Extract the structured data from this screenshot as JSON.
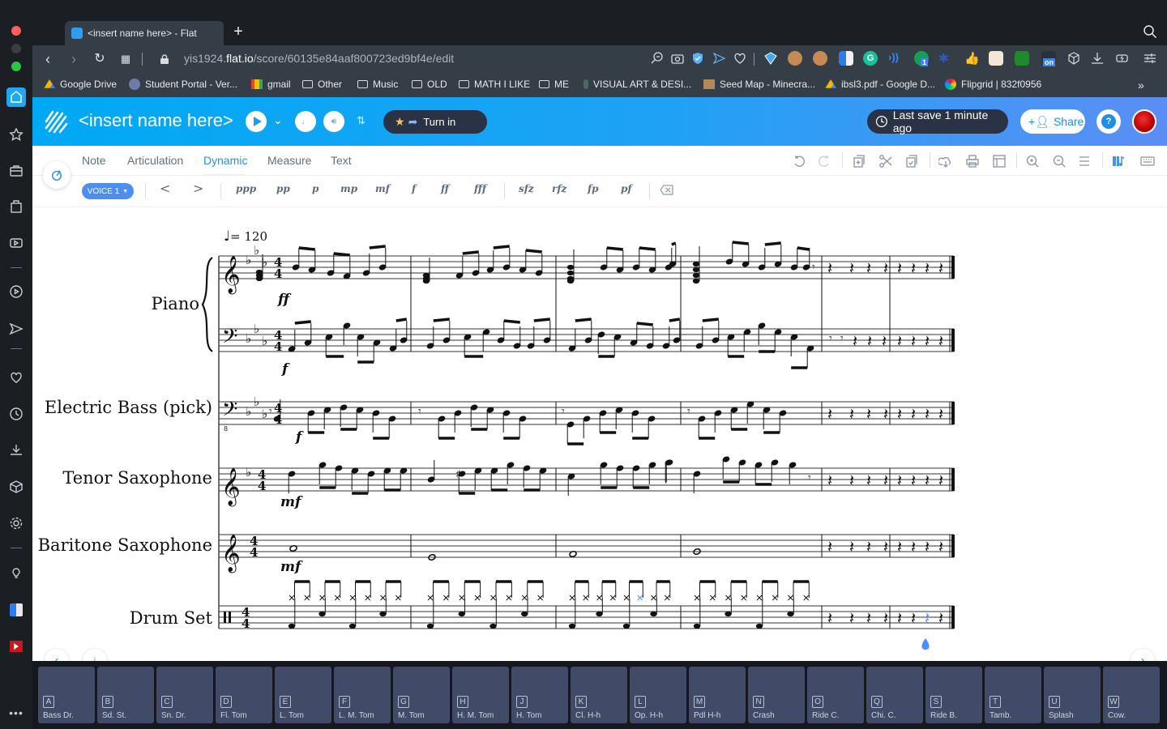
{
  "browser": {
    "tab_title": "<insert name here> - Flat",
    "url_prefix": "yis1924.",
    "url_domain": "flat.io",
    "url_path": "/score/60135e84aaf800723ed9bf4e/edit",
    "bookmarks": [
      {
        "label": "Google Drive",
        "icon": "google-drive-icon"
      },
      {
        "label": "Student Portal - Ver...",
        "icon": "portal-icon"
      },
      {
        "label": "gmail",
        "icon": "gmail-icon"
      },
      {
        "label": "Other",
        "icon": "folder-icon"
      },
      {
        "label": "Music",
        "icon": "folder-icon"
      },
      {
        "label": "OLD",
        "icon": "folder-icon"
      },
      {
        "label": "MATH I LIKE",
        "icon": "folder-icon"
      },
      {
        "label": "ME",
        "icon": "folder-icon"
      },
      {
        "label": "VISUAL ART & DESI...",
        "icon": "art-icon"
      },
      {
        "label": "Seed Map - Minecra...",
        "icon": "minecraft-icon"
      },
      {
        "label": "ibsl3.pdf - Google D...",
        "icon": "google-drive-icon"
      },
      {
        "label": "Flipgrid | 832f0956",
        "icon": "flipgrid-icon"
      }
    ],
    "extension_badge": "1",
    "extension_on_badge": "on"
  },
  "header": {
    "title": "<insert name here>",
    "turn_in": "Turn in",
    "last_save": "Last save 1 minute ago",
    "share": "Share"
  },
  "toolbar": {
    "tabs": [
      "Note",
      "Articulation",
      "Dynamic",
      "Measure",
      "Text"
    ],
    "active_tab": "Dynamic",
    "voice": "VOICE 1",
    "hairpins": [
      "<",
      ">"
    ],
    "dynamics": [
      "ppp",
      "pp",
      "p",
      "mp",
      "mf",
      "f",
      "ff",
      "fff"
    ],
    "accents": [
      "sfz",
      "rfz",
      "fp",
      "pf"
    ]
  },
  "score": {
    "tempo": "= 120",
    "instruments": [
      {
        "name": "Piano",
        "dynamic_treble": "ff",
        "dynamic_bass": "f"
      },
      {
        "name": "Electric Bass (pick)",
        "dynamic": "f"
      },
      {
        "name": "Tenor Saxophone",
        "dynamic": "mf"
      },
      {
        "name": "Baritone Saxophone",
        "dynamic": "mf"
      },
      {
        "name": "Drum Set"
      }
    ],
    "time_signature": "4/4",
    "measures": 6
  },
  "drum_pad": {
    "pads": [
      {
        "key": "A",
        "label": "Bass Dr."
      },
      {
        "key": "B",
        "label": "Sd. St."
      },
      {
        "key": "C",
        "label": "Sn. Dr."
      },
      {
        "key": "D",
        "label": "Fl. Tom"
      },
      {
        "key": "E",
        "label": "L. Tom"
      },
      {
        "key": "F",
        "label": "L. M. Tom"
      },
      {
        "key": "G",
        "label": "M. Tom"
      },
      {
        "key": "H",
        "label": "H. M. Tom"
      },
      {
        "key": "J",
        "label": "H. Tom"
      },
      {
        "key": "K",
        "label": "Cl. H-h"
      },
      {
        "key": "L",
        "label": "Op. H-h"
      },
      {
        "key": "M",
        "label": "Pdl H-h"
      },
      {
        "key": "N",
        "label": "Crash"
      },
      {
        "key": "O",
        "label": "Ride C."
      },
      {
        "key": "Q",
        "label": "Chi. C."
      },
      {
        "key": "S",
        "label": "Ride B."
      },
      {
        "key": "T",
        "label": "Tamb."
      },
      {
        "key": "U",
        "label": "Splash"
      },
      {
        "key": "W",
        "label": "Cow."
      }
    ]
  },
  "colors": {
    "brand": "#00a9f4",
    "accent_blue": "#4d8ff0",
    "selection": "#4a90f5"
  }
}
